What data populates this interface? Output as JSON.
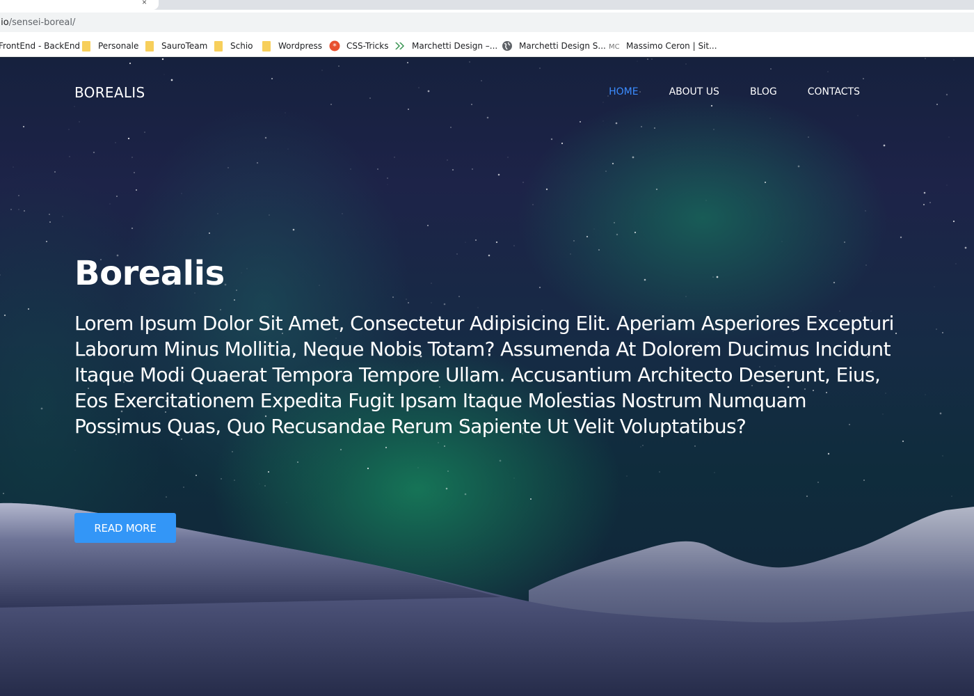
{
  "browser": {
    "url_host": "",
    "url_prefix": ".io",
    "url_path": "/sensei-boreal/",
    "bookmarks": [
      {
        "label": "FrontEnd - BackEnd",
        "icon": "folder-icon"
      },
      {
        "label": "Personale",
        "icon": "folder-icon"
      },
      {
        "label": "SauroTeam",
        "icon": "folder-icon"
      },
      {
        "label": "Schio",
        "icon": "folder-icon"
      },
      {
        "label": "Wordpress",
        "icon": "folder-icon"
      },
      {
        "label": "CSS-Tricks",
        "icon": "css-tricks-icon"
      },
      {
        "label": "Marchetti Design –...",
        "icon": "chevron-logo-icon"
      },
      {
        "label": "Marchetti Design S...",
        "icon": "globe-icon"
      },
      {
        "label": "Massimo Ceron | Sit...",
        "icon": "mc-logo-icon"
      }
    ]
  },
  "site": {
    "brand": "BOREALIS",
    "nav": [
      {
        "label": "HOME",
        "active": true
      },
      {
        "label": "ABOUT US",
        "active": false
      },
      {
        "label": "BLOG",
        "active": false
      },
      {
        "label": "CONTACTS",
        "active": false
      }
    ],
    "hero": {
      "title": "Borealis",
      "text": "Lorem Ipsum Dolor Sit Amet, Consectetur Adipisicing Elit. Aperiam Asperiores Excepturi Laborum Minus Mollitia, Neque Nobis Totam? Assumenda At Dolorem Ducimus Incidunt Itaque Modi Quaerat Tempora Tempore Ullam. Accusantium Architecto Deserunt, Eius, Eos Exercitationem Expedita Fugit Ipsam Itaque Molestias Nostrum Numquam Possimus Quas, Quo Recusandae Rerum Sapiente Ut Velit Voluptatibus?",
      "cta": "READ MORE"
    }
  },
  "colors": {
    "accent": "#3396f7",
    "nav_active": "#3b8cff",
    "folder": "#f7cf5b"
  }
}
